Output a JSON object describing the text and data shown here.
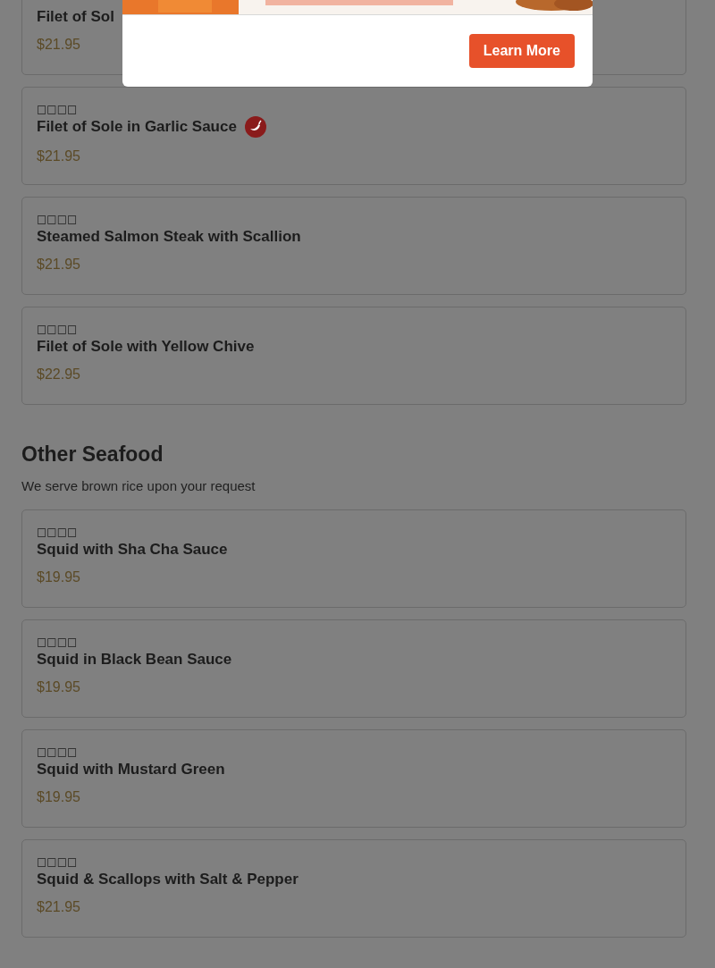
{
  "modal": {
    "button": "Learn More"
  },
  "sections": [
    {
      "items": [
        {
          "name": "Filet of Sol",
          "price": "$21.95",
          "spicy": false
        },
        {
          "chinese": "□□□□",
          "name": "Filet of Sole in Garlic Sauce",
          "price": "$21.95",
          "spicy": true
        },
        {
          "chinese": "□□□□",
          "name": "Steamed Salmon Steak with Scallion",
          "price": "$21.95",
          "spicy": false
        },
        {
          "chinese": "□□□□",
          "name": "Filet of Sole with Yellow Chive",
          "price": "$22.95",
          "spicy": false
        }
      ]
    },
    {
      "title": "Other Seafood",
      "subtitle": "We serve brown rice upon your request",
      "items": [
        {
          "chinese": "□□□□",
          "name": "Squid with Sha Cha Sauce",
          "price": "$19.95",
          "spicy": false
        },
        {
          "chinese": "□□□□",
          "name": "Squid in Black Bean Sauce",
          "price": "$19.95",
          "spicy": false
        },
        {
          "chinese": "□□□□",
          "name": "Squid with Mustard Green",
          "price": "$19.95",
          "spicy": false
        },
        {
          "chinese": "□□□□",
          "name": "Squid & Scallops with Salt & Pepper",
          "price": "$21.95",
          "spicy": false
        }
      ]
    }
  ]
}
